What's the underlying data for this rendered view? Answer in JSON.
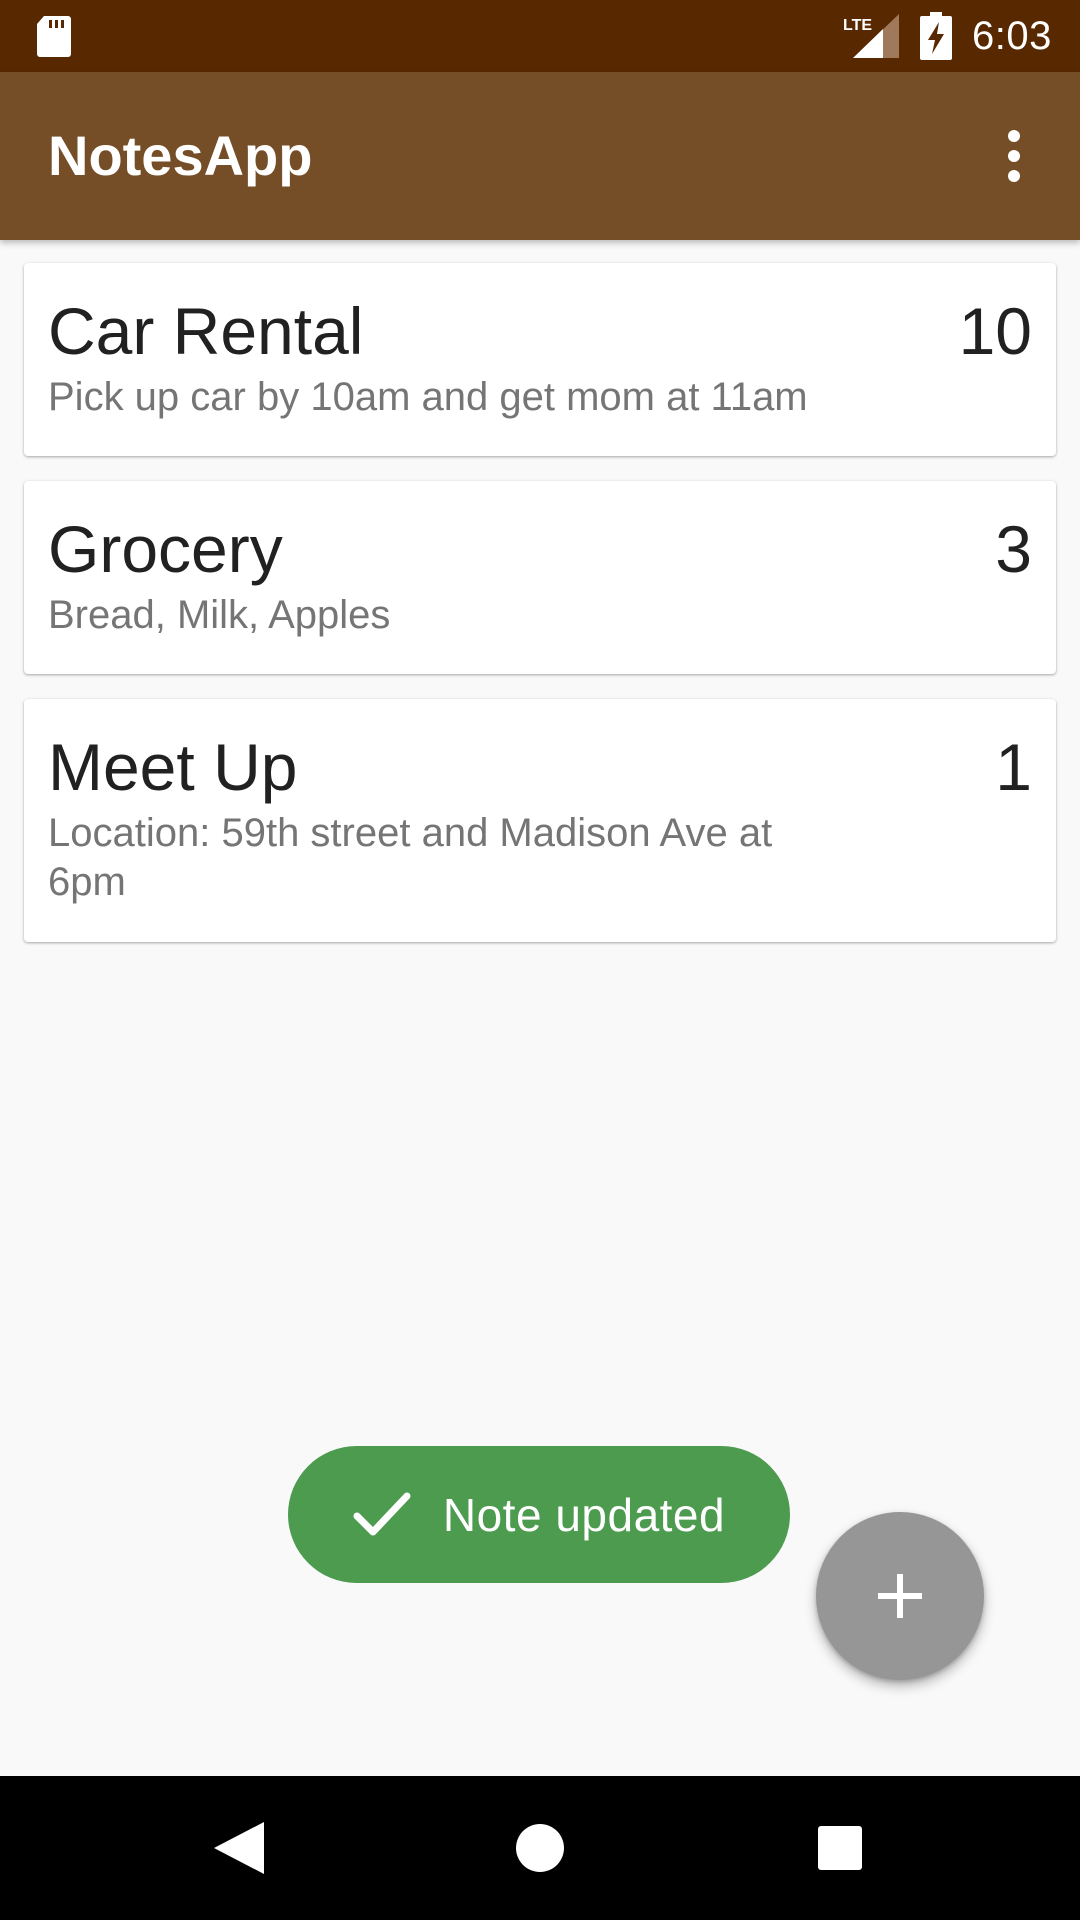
{
  "status_bar": {
    "time": "6:03",
    "network": "LTE",
    "icons": [
      "sd-card-icon",
      "lte-signal-icon",
      "battery-charging-icon"
    ]
  },
  "app_bar": {
    "title": "NotesApp",
    "overflow_icon": "more-vert-icon",
    "background": "#754e27"
  },
  "notes": [
    {
      "title": "Car Rental",
      "body": "Pick up car by 10am and get mom at 11am",
      "count": "10"
    },
    {
      "title": "Grocery",
      "body": "Bread, Milk, Apples",
      "count": "3"
    },
    {
      "title": "Meet Up",
      "body": "Location: 59th street and Madison Ave at 6pm",
      "count": "1"
    }
  ],
  "toast": {
    "icon": "check-icon",
    "message": "Note updated",
    "color": "#4d9b4f"
  },
  "fab": {
    "icon": "plus-icon",
    "color": "#969696"
  },
  "nav_bar": {
    "icons": [
      "back-icon",
      "home-icon",
      "recents-icon"
    ]
  },
  "colors": {
    "status_bar": "#582800",
    "background": "#f9f9f9"
  }
}
